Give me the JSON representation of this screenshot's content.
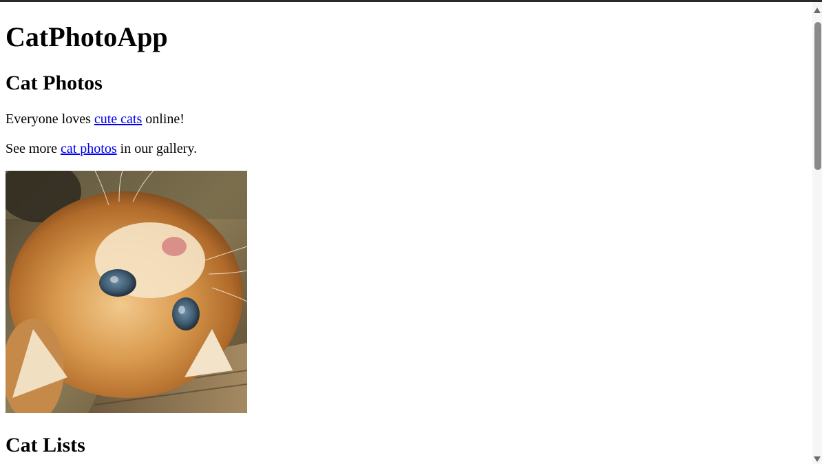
{
  "colors": {
    "link": "#0000ee",
    "text": "#000000",
    "background": "#ffffff",
    "scrollbar_thumb": "#8a8a8a",
    "scrollbar_track": "#f6f6f6"
  },
  "header": {
    "title": "CatPhotoApp"
  },
  "main": {
    "section_photos": {
      "heading": "Cat Photos",
      "para1": {
        "before": "Everyone loves ",
        "link": "cute cats",
        "after": " online!"
      },
      "para2": {
        "before": "See more ",
        "link": "cat photos",
        "after": " in our gallery."
      },
      "image": {
        "icon": "cat-photo-image"
      }
    },
    "section_lists": {
      "heading": "Cat Lists"
    }
  },
  "scrollbar": {
    "up_icon": "scroll-up-arrow-icon",
    "down_icon": "scroll-down-arrow-icon",
    "thumb_fraction": 0.33
  }
}
